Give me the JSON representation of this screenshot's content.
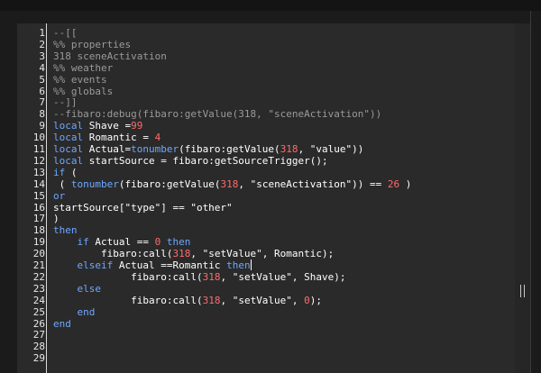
{
  "editor": {
    "colors": {
      "background": "#2a2a2a",
      "comment": "#9a9a9a",
      "keyword": "#6ea7ff",
      "number": "#ff6b6b",
      "default": "#ffffff",
      "line_number": "#e9e9e9"
    },
    "lines": [
      {
        "n": "1",
        "tokens": [
          {
            "t": "--[[",
            "c": "comment"
          }
        ]
      },
      {
        "n": "2",
        "tokens": [
          {
            "t": "%% properties",
            "c": "comment"
          }
        ]
      },
      {
        "n": "3",
        "tokens": [
          {
            "t": "318 sceneActivation",
            "c": "comment"
          }
        ]
      },
      {
        "n": "4",
        "tokens": [
          {
            "t": "%% weather",
            "c": "comment"
          }
        ]
      },
      {
        "n": "5",
        "tokens": [
          {
            "t": "%% events",
            "c": "comment"
          }
        ]
      },
      {
        "n": "6",
        "tokens": [
          {
            "t": "%% globals",
            "c": "comment"
          }
        ]
      },
      {
        "n": "7",
        "tokens": [
          {
            "t": "--]]",
            "c": "comment"
          }
        ]
      },
      {
        "n": "8",
        "tokens": [
          {
            "t": "--fibaro:debug(fibaro:getValue(318, \"sceneActivation\"))",
            "c": "comment"
          }
        ]
      },
      {
        "n": "9",
        "tokens": [
          {
            "t": "local",
            "c": "keyword"
          },
          {
            "t": " Shave =",
            "c": "default"
          },
          {
            "t": "99",
            "c": "number"
          }
        ]
      },
      {
        "n": "10",
        "tokens": [
          {
            "t": "local",
            "c": "keyword"
          },
          {
            "t": " Romantic = ",
            "c": "default"
          },
          {
            "t": "4",
            "c": "number"
          }
        ]
      },
      {
        "n": "11",
        "tokens": [
          {
            "t": "local",
            "c": "keyword"
          },
          {
            "t": " Actual=",
            "c": "default"
          },
          {
            "t": "tonumber",
            "c": "keyword"
          },
          {
            "t": "(fibaro:getValue(",
            "c": "default"
          },
          {
            "t": "318",
            "c": "number"
          },
          {
            "t": ", \"value\"))",
            "c": "default"
          }
        ]
      },
      {
        "n": "12",
        "tokens": [
          {
            "t": "local",
            "c": "keyword"
          },
          {
            "t": " startSource = fibaro:getSourceTrigger();",
            "c": "default"
          }
        ]
      },
      {
        "n": "13",
        "tokens": [
          {
            "t": "if",
            "c": "keyword"
          },
          {
            "t": " (",
            "c": "default"
          }
        ]
      },
      {
        "n": "14",
        "tokens": [
          {
            "t": " ( ",
            "c": "default"
          },
          {
            "t": "tonumber",
            "c": "keyword"
          },
          {
            "t": "(fibaro:getValue(",
            "c": "default"
          },
          {
            "t": "318",
            "c": "number"
          },
          {
            "t": ", \"sceneActivation\")) == ",
            "c": "default"
          },
          {
            "t": "26",
            "c": "number"
          },
          {
            "t": " )",
            "c": "default"
          }
        ]
      },
      {
        "n": "15",
        "tokens": [
          {
            "t": "or",
            "c": "keyword"
          }
        ]
      },
      {
        "n": "16",
        "tokens": [
          {
            "t": "startSource[\"type\"] == \"other\"",
            "c": "default"
          }
        ]
      },
      {
        "n": "17",
        "tokens": [
          {
            "t": ")",
            "c": "default"
          }
        ]
      },
      {
        "n": "18",
        "tokens": [
          {
            "t": "then",
            "c": "keyword"
          }
        ]
      },
      {
        "n": "19",
        "tokens": [
          {
            "t": "    ",
            "c": "default"
          },
          {
            "t": "if",
            "c": "keyword"
          },
          {
            "t": " Actual == ",
            "c": "default"
          },
          {
            "t": "0",
            "c": "number"
          },
          {
            "t": " ",
            "c": "default"
          },
          {
            "t": "then",
            "c": "keyword"
          }
        ]
      },
      {
        "n": "20",
        "tokens": [
          {
            "t": "        fibaro:call(",
            "c": "default"
          },
          {
            "t": "318",
            "c": "number"
          },
          {
            "t": ", \"setValue\", Romantic);",
            "c": "default"
          }
        ]
      },
      {
        "n": "21",
        "tokens": [
          {
            "t": "    ",
            "c": "default"
          },
          {
            "t": "elseif",
            "c": "keyword"
          },
          {
            "t": " Actual ==Romantic ",
            "c": "default"
          },
          {
            "t": "then",
            "c": "keyword"
          },
          {
            "t": "",
            "c": "cursor"
          }
        ]
      },
      {
        "n": "22",
        "tokens": [
          {
            "t": "             fibaro:call(",
            "c": "default"
          },
          {
            "t": "318",
            "c": "number"
          },
          {
            "t": ", \"setValue\", Shave);",
            "c": "default"
          }
        ]
      },
      {
        "n": "23",
        "tokens": [
          {
            "t": "    ",
            "c": "default"
          },
          {
            "t": "else",
            "c": "keyword"
          }
        ]
      },
      {
        "n": "24",
        "tokens": [
          {
            "t": "             fibaro:call(",
            "c": "default"
          },
          {
            "t": "318",
            "c": "number"
          },
          {
            "t": ", \"setValue\", ",
            "c": "default"
          },
          {
            "t": "0",
            "c": "number"
          },
          {
            "t": ");",
            "c": "default"
          }
        ]
      },
      {
        "n": "25",
        "tokens": [
          {
            "t": "    ",
            "c": "default"
          },
          {
            "t": "end",
            "c": "keyword"
          }
        ]
      },
      {
        "n": "26",
        "tokens": [
          {
            "t": "end",
            "c": "keyword"
          }
        ]
      },
      {
        "n": "27",
        "tokens": []
      },
      {
        "n": "28",
        "tokens": []
      },
      {
        "n": "29",
        "tokens": []
      }
    ]
  }
}
